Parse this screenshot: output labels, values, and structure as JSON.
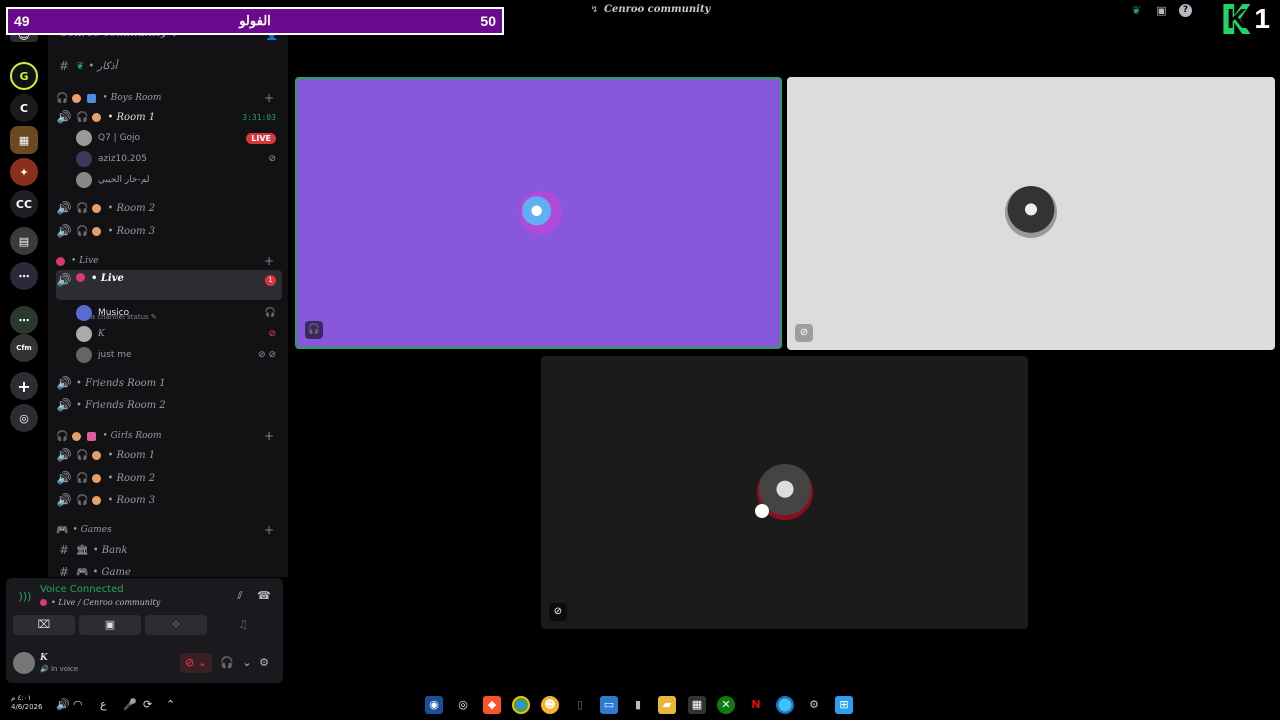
{
  "overlay": {
    "left_count": "49",
    "center_text": "الفولو",
    "right_count": "50"
  },
  "window": {
    "title": "Cenroo community"
  },
  "badge": {
    "number": "1"
  },
  "server": {
    "name": "Cenroo community"
  },
  "channels": {
    "text_top": "• أذكار",
    "boys_room": {
      "category": "• Boys Room",
      "rooms": [
        "• Room 1",
        "• Room 2",
        "• Room 3"
      ],
      "timer": "3:31:03",
      "users": [
        "Q7 | Gojo",
        "aziz10.205",
        "لم-خار الحيبي"
      ],
      "live_label": "LIVE"
    },
    "live": {
      "category": "• Live",
      "channel": "• Live",
      "status_placeholder": "Set a channel status",
      "notif": "1",
      "users": [
        "Musico",
        "K",
        "just me"
      ]
    },
    "friends": [
      "• Friends Room 1",
      "• Friends Room 2"
    ],
    "girls_room": {
      "category": "• Girls Room",
      "rooms": [
        "• Room 1",
        "• Room 2",
        "• Room 3"
      ]
    },
    "games": {
      "category": "• Games",
      "channels": [
        "• Bank",
        "• Game"
      ]
    }
  },
  "voice": {
    "title": "Voice Connected",
    "subtitle": "• Live / Cenroo community"
  },
  "user": {
    "name": "K",
    "status": "In voice"
  },
  "taskbar": {
    "time": "٤:٠١ م",
    "date": "4/6/2026",
    "lang": "ع"
  },
  "colors": {
    "accent_purple": "#8757dc",
    "voice_green": "#23a55a",
    "live_red": "#da373c",
    "overlay_bg": "#6a0a8e",
    "badge_green": "#20d46b"
  }
}
